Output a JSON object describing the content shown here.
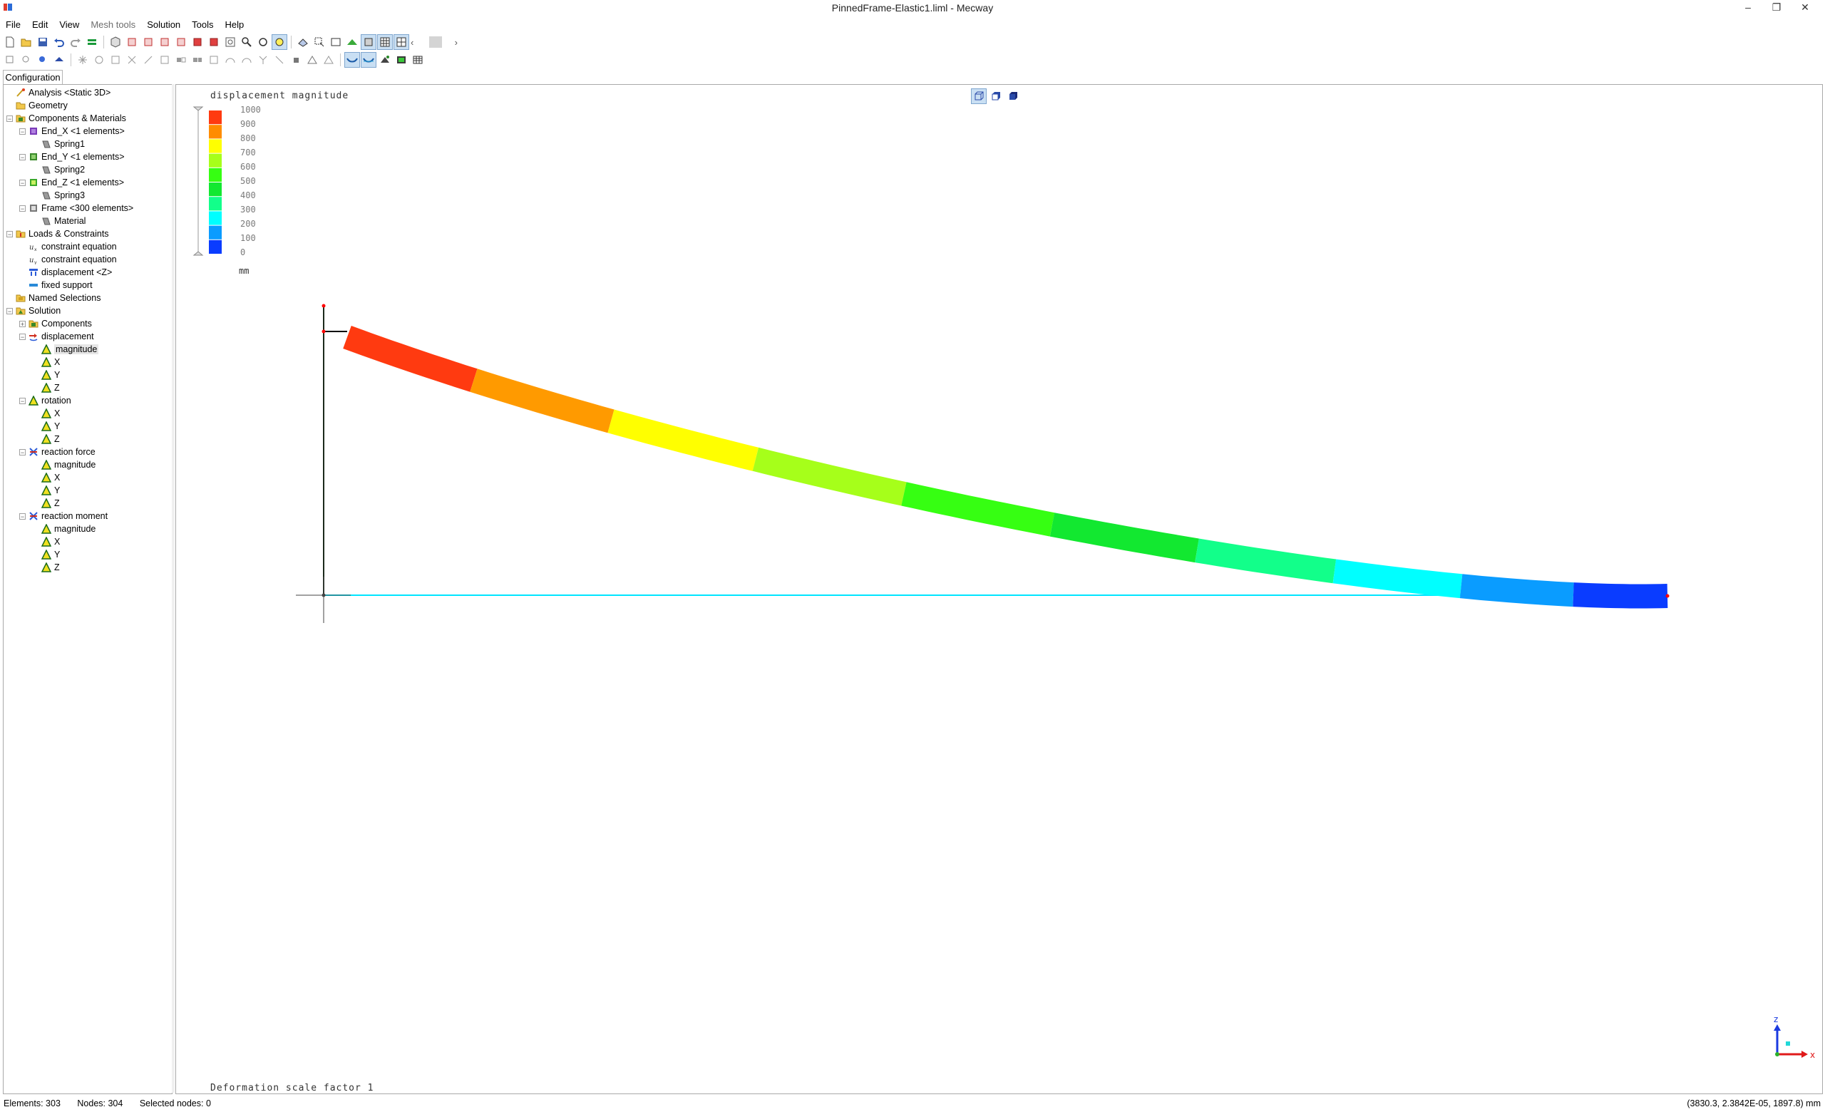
{
  "window": {
    "title": "PinnedFrame-Elastic1.liml - Mecway",
    "controls": [
      "–",
      "❐",
      "✕"
    ]
  },
  "menu": {
    "items": [
      {
        "label": "File",
        "enabled": true
      },
      {
        "label": "Edit",
        "enabled": true
      },
      {
        "label": "View",
        "enabled": true
      },
      {
        "label": "Mesh tools",
        "enabled": false
      },
      {
        "label": "Solution",
        "enabled": true
      },
      {
        "label": "Tools",
        "enabled": true
      },
      {
        "label": "Help",
        "enabled": true
      }
    ]
  },
  "panel": {
    "tab_label": "Configuration",
    "tree": [
      {
        "label": "Analysis <Static 3D>",
        "icon": "analysis-icon"
      },
      {
        "label": "Geometry",
        "icon": "folder-icon"
      },
      {
        "label": "Components & Materials",
        "icon": "components-icon"
      },
      {
        "label": "End_X <1 elements>",
        "icon": "component-icon"
      },
      {
        "label": "Spring1",
        "icon": "material-icon"
      },
      {
        "label": "End_Y <1 elements>",
        "icon": "component-icon"
      },
      {
        "label": "Spring2",
        "icon": "material-icon"
      },
      {
        "label": "End_Z <1 elements>",
        "icon": "component-icon"
      },
      {
        "label": "Spring3",
        "icon": "material-icon"
      },
      {
        "label": "Frame <300 elements>",
        "icon": "component-icon"
      },
      {
        "label": "Material",
        "icon": "material-icon"
      },
      {
        "label": "Loads & Constraints",
        "icon": "loads-icon"
      },
      {
        "label": "constraint equation",
        "icon": "constraint-equation-icon"
      },
      {
        "label": "constraint equation",
        "icon": "constraint-equation-icon"
      },
      {
        "label": "displacement <Z>",
        "icon": "displacement-icon"
      },
      {
        "label": "fixed support",
        "icon": "fixed-support-icon"
      },
      {
        "label": "Named Selections",
        "icon": "named-selections-icon"
      },
      {
        "label": "Solution",
        "icon": "solution-icon"
      },
      {
        "label": "Components",
        "icon": "components-icon"
      },
      {
        "label": "displacement",
        "icon": "displacement-result-icon"
      },
      {
        "label": "magnitude",
        "icon": "result-icon"
      },
      {
        "label": "X",
        "icon": "result-icon"
      },
      {
        "label": "Y",
        "icon": "result-icon"
      },
      {
        "label": "Z",
        "icon": "result-icon"
      },
      {
        "label": "rotation",
        "icon": "result-icon"
      },
      {
        "label": "X",
        "icon": "result-icon"
      },
      {
        "label": "Y",
        "icon": "result-icon"
      },
      {
        "label": "Z",
        "icon": "result-icon"
      },
      {
        "label": "reaction force",
        "icon": "reaction-icon"
      },
      {
        "label": "magnitude",
        "icon": "result-icon"
      },
      {
        "label": "X",
        "icon": "result-icon"
      },
      {
        "label": "Y",
        "icon": "result-icon"
      },
      {
        "label": "Z",
        "icon": "result-icon"
      },
      {
        "label": "reaction moment",
        "icon": "reaction-icon"
      },
      {
        "label": "magnitude",
        "icon": "result-icon"
      },
      {
        "label": "X",
        "icon": "result-icon"
      },
      {
        "label": "Y",
        "icon": "result-icon"
      },
      {
        "label": "Z",
        "icon": "result-icon"
      }
    ],
    "selected_item": "magnitude"
  },
  "viewport": {
    "legend": {
      "title": "displacement magnitude",
      "unit": "mm",
      "labels": [
        "1000",
        "900",
        "800",
        "700",
        "600",
        "500",
        "400",
        "300",
        "200",
        "100",
        "0"
      ],
      "colors": [
        "#ff3a10",
        "#ff8c00",
        "#ffff00",
        "#a6ff1a",
        "#36ff12",
        "#12e830",
        "#12ff8a",
        "#00ffff",
        "#0a9cff",
        "#0a3cff"
      ]
    },
    "beam_segment_colors": [
      "#ff3a10",
      "#ff9a00",
      "#ffff00",
      "#a6ff1a",
      "#36ff12",
      "#12e830",
      "#12ff8a",
      "#00ffff",
      "#0a9cff",
      "#0a3cff"
    ],
    "deformation_text": "Deformation scale factor 1",
    "axes": {
      "x_label": "x",
      "z_label": "z"
    },
    "undeformed_color": "#00e5ff"
  },
  "status": {
    "elements": "Elements: 303",
    "nodes": "Nodes: 304",
    "selected": "Selected nodes: 0",
    "coordinates": "(3830.3, 2.3842E-05, 1897.8) mm"
  }
}
